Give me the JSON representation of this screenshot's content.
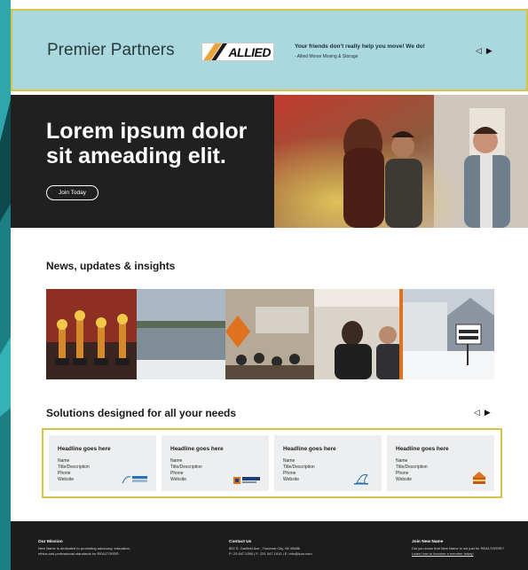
{
  "colors": {
    "teal_bg": "#0e4a4d",
    "banner_bg": "#a9d8df",
    "accent_border": "#d8c34a",
    "hero_dark": "#202020",
    "footer_dark": "#1c1c1c",
    "card_bg": "#eceeef"
  },
  "partners": {
    "title": "Premier Partners",
    "logo_text": "ALLIED",
    "quote": "Your friends don't really help you move! We do!",
    "sub": "- Allied Morse Moving & Storage",
    "prev_icon": "◁",
    "next_icon": "▶"
  },
  "hero": {
    "title": "Lorem ipsum dolor sit ameading elit.",
    "button": "Join Today"
  },
  "news": {
    "heading": "News, updates & insights"
  },
  "solutions": {
    "heading": "Solutions designed for all your needs",
    "prev_icon": "◁",
    "next_icon": "▶",
    "cards": [
      {
        "title": "Headline goes here",
        "line1": "Name",
        "line2": "Title/Description",
        "line3": "Phone",
        "line4": "Website",
        "logo_icon": "realtor-logo-icon"
      },
      {
        "title": "Headline goes here",
        "line1": "Name",
        "line2": "Title/Description",
        "line3": "Phone",
        "line4": "Website",
        "logo_icon": "honor-logo-icon"
      },
      {
        "title": "Headline goes here",
        "line1": "Name",
        "line2": "Title/Description",
        "line3": "Phone",
        "line4": "Website",
        "logo_icon": "sail-logo-icon"
      },
      {
        "title": "Headline goes here",
        "line1": "Name",
        "line2": "Title/Description",
        "line3": "Phone",
        "line4": "Website",
        "logo_icon": "house-logo-icon"
      }
    ]
  },
  "footer": {
    "mission_title": "Our Mission",
    "mission_text1": "New Name is dedicated to promoting advocacy, education,",
    "mission_text2": "ethics and professional standards for REALTORS®.",
    "contact_title": "Contact Us",
    "contact_addr": "852 S. Garfield Ave., Traverse City, MI 49686",
    "contact_phone": "P: 23.947.2050  |  F: 231.947.1910  |  E: info@tuar.com",
    "join_title": "Join New Name",
    "join_text": "Did you know that New Name is not just for REALTORS®?",
    "join_link": "Learn how to become a member today!"
  }
}
